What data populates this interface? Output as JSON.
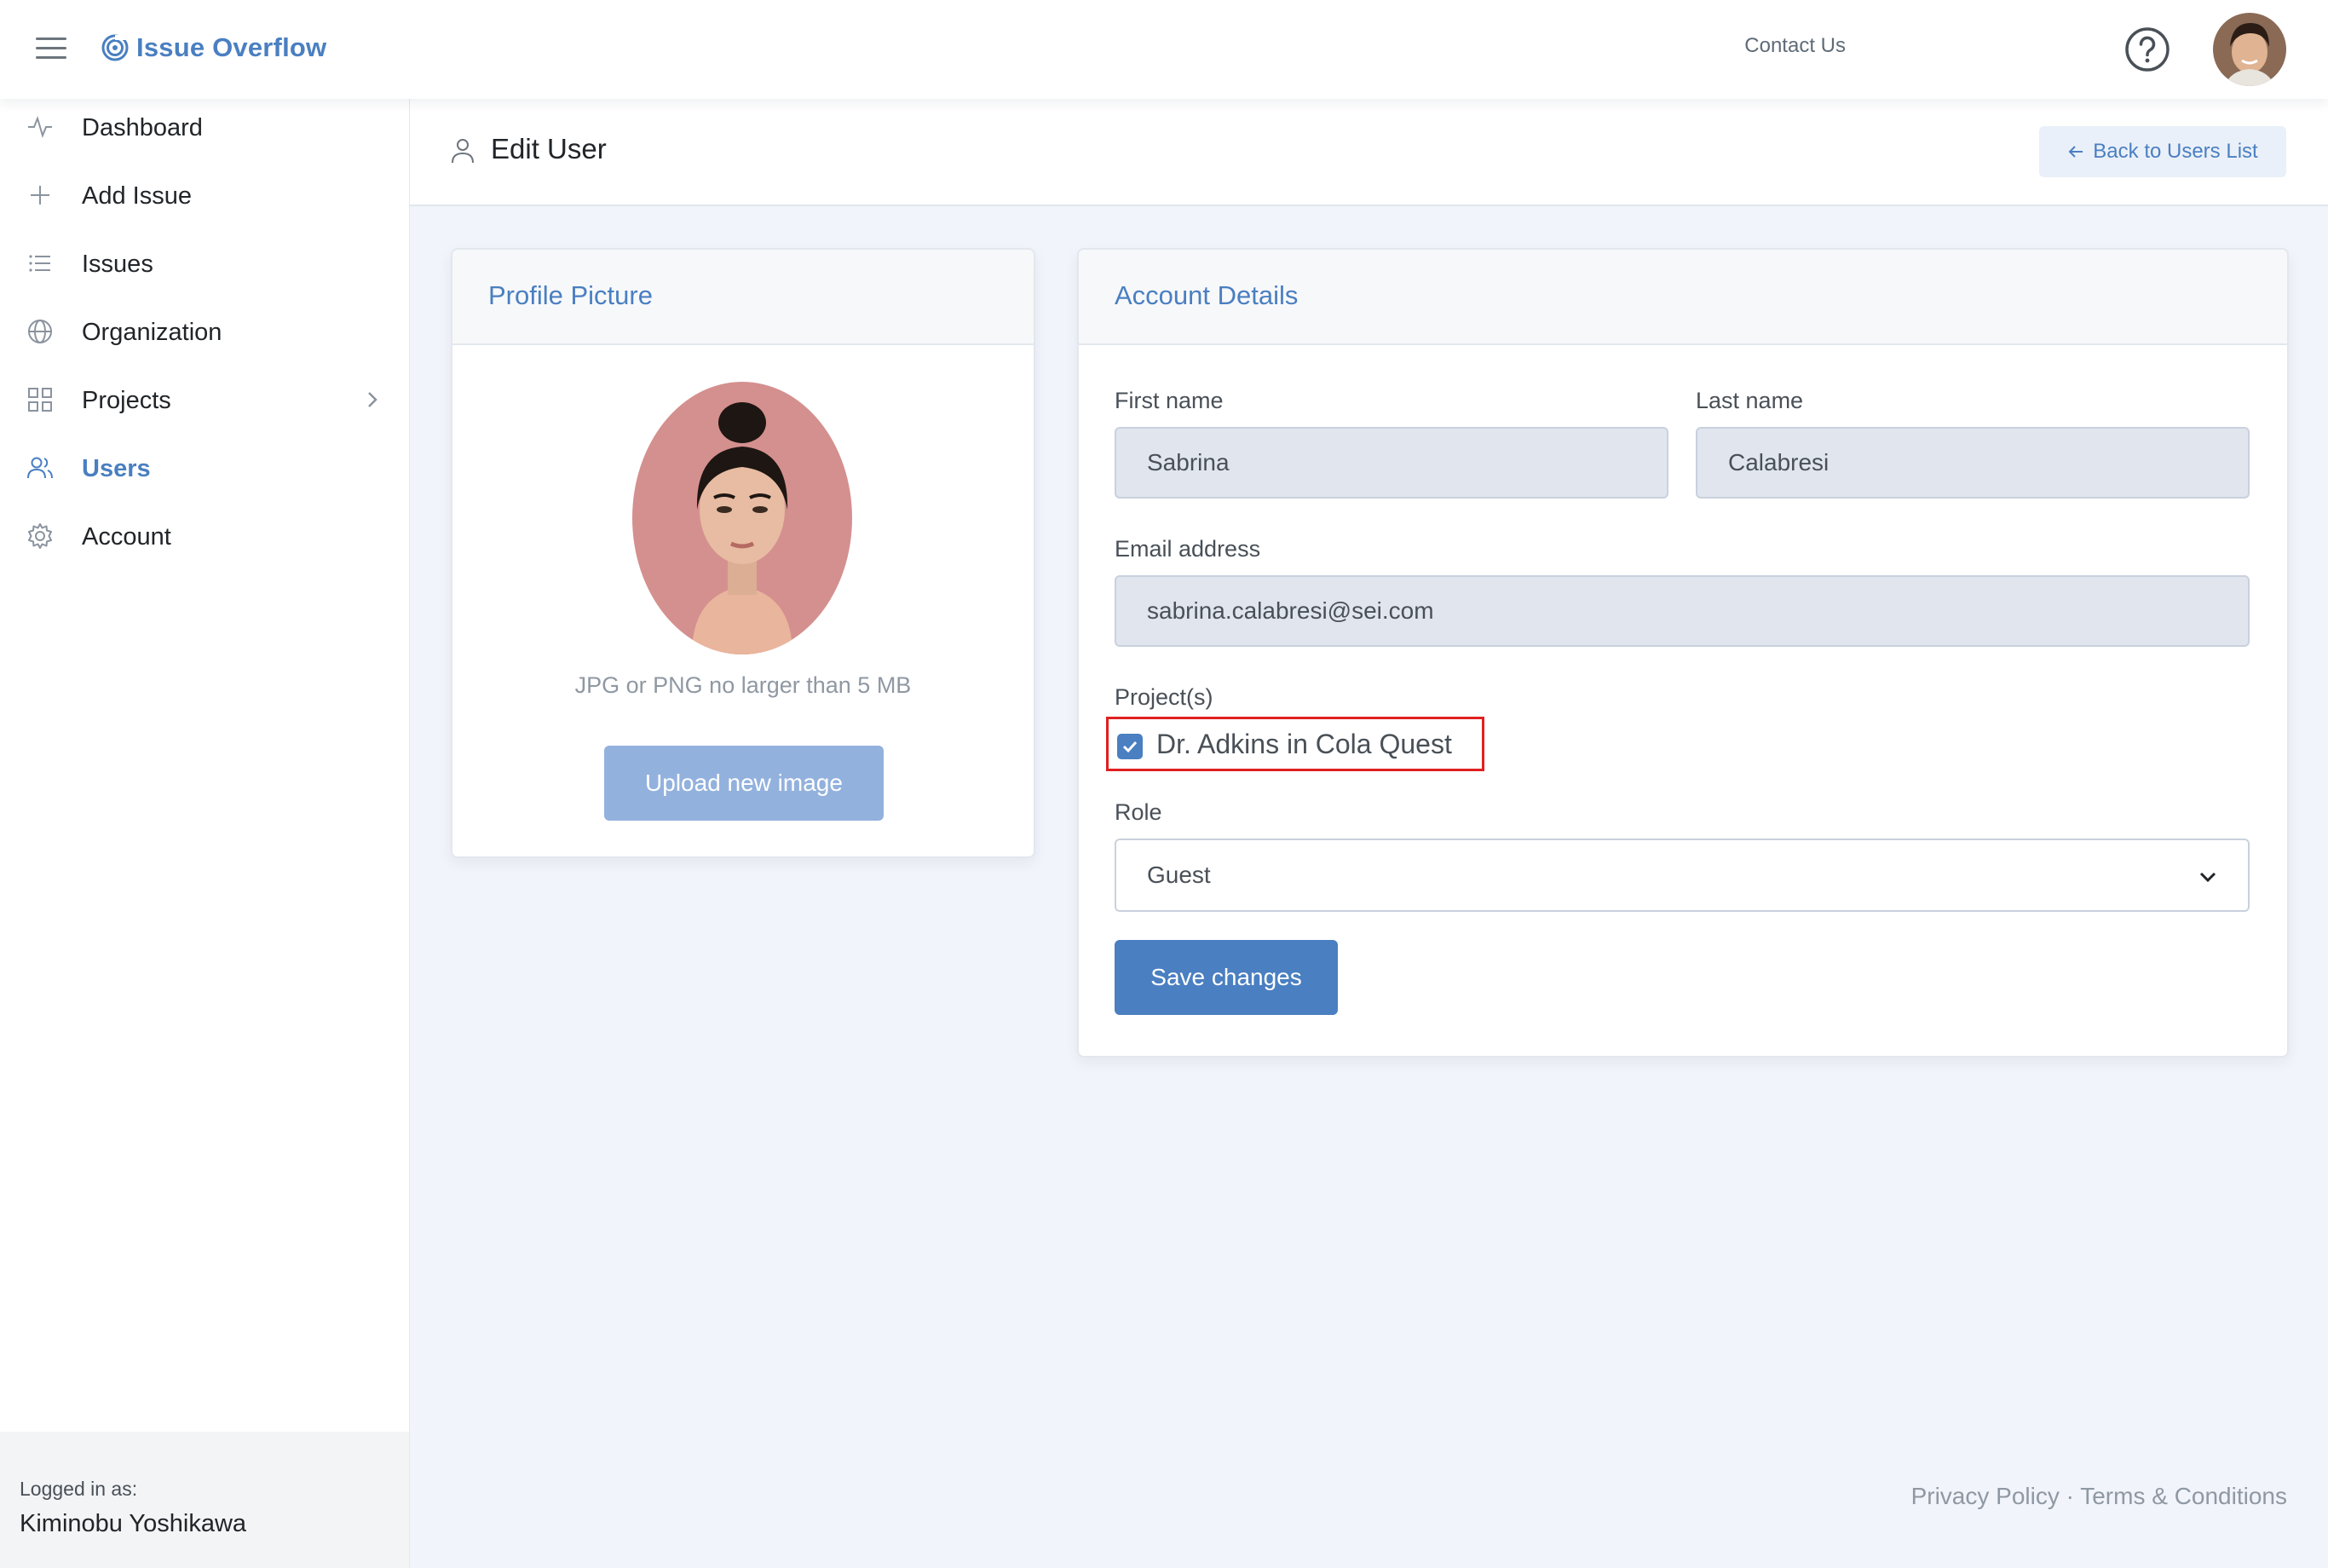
{
  "app": {
    "name": "Issue Overflow"
  },
  "topbar": {
    "contact_label": "Contact Us"
  },
  "sidebar": {
    "items": [
      {
        "label": "Dashboard",
        "icon": "activity-icon"
      },
      {
        "label": "Add Issue",
        "icon": "plus-icon"
      },
      {
        "label": "Issues",
        "icon": "list-icon"
      },
      {
        "label": "Organization",
        "icon": "globe-icon"
      },
      {
        "label": "Projects",
        "icon": "grid-icon"
      },
      {
        "label": "Users",
        "icon": "users-icon",
        "active": true
      },
      {
        "label": "Account",
        "icon": "gear-icon"
      }
    ],
    "logged_in_label": "Logged in as:",
    "logged_in_user": "Kiminobu Yoshikawa"
  },
  "page": {
    "title": "Edit User",
    "back_button": "Back to Users List"
  },
  "profile": {
    "card_title": "Profile Picture",
    "hint": "JPG or PNG no larger than 5 MB",
    "upload_button": "Upload new image"
  },
  "account": {
    "card_title": "Account Details",
    "first_name_label": "First name",
    "first_name": "Sabrina",
    "last_name_label": "Last name",
    "last_name": "Calabresi",
    "email_label": "Email address",
    "email": "sabrina.calabresi@sei.com",
    "projects_label": "Project(s)",
    "project_option": "Dr. Adkins in Cola Quest",
    "project_checked": true,
    "role_label": "Role",
    "role": "Guest",
    "save_button": "Save changes"
  },
  "footer": {
    "privacy": "Privacy Policy",
    "separator": "·",
    "terms": "Terms & Conditions"
  },
  "colors": {
    "accent": "#4a7fc1",
    "highlight_border": "#e02020",
    "page_bg": "#f1f4fa"
  }
}
